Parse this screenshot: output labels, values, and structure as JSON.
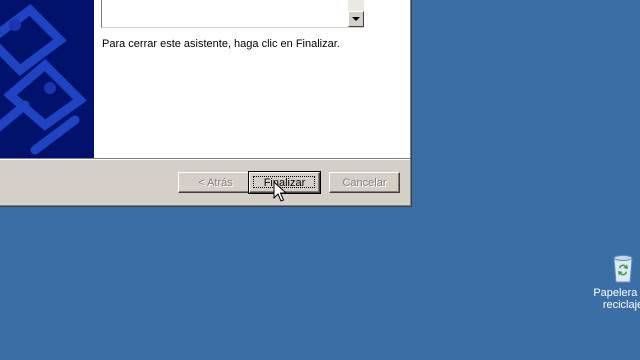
{
  "wizard": {
    "finish_instruction": "Para cerrar este asistente, haga clic en Finalizar.",
    "buttons": {
      "back": "< Atrás",
      "finish": "Finalizar",
      "cancel": "Cancelar"
    },
    "back_enabled": false,
    "cancel_enabled": false,
    "default_button": "finish"
  },
  "desktop": {
    "background_color": "#3a6ea5",
    "icons": [
      {
        "name": "recycle-bin-icon",
        "label_line1": "Papelera de",
        "label_line2": "reciclaje"
      }
    ]
  },
  "colors": {
    "banner": "#00126b",
    "dialog_face": "#d4d0c8"
  }
}
